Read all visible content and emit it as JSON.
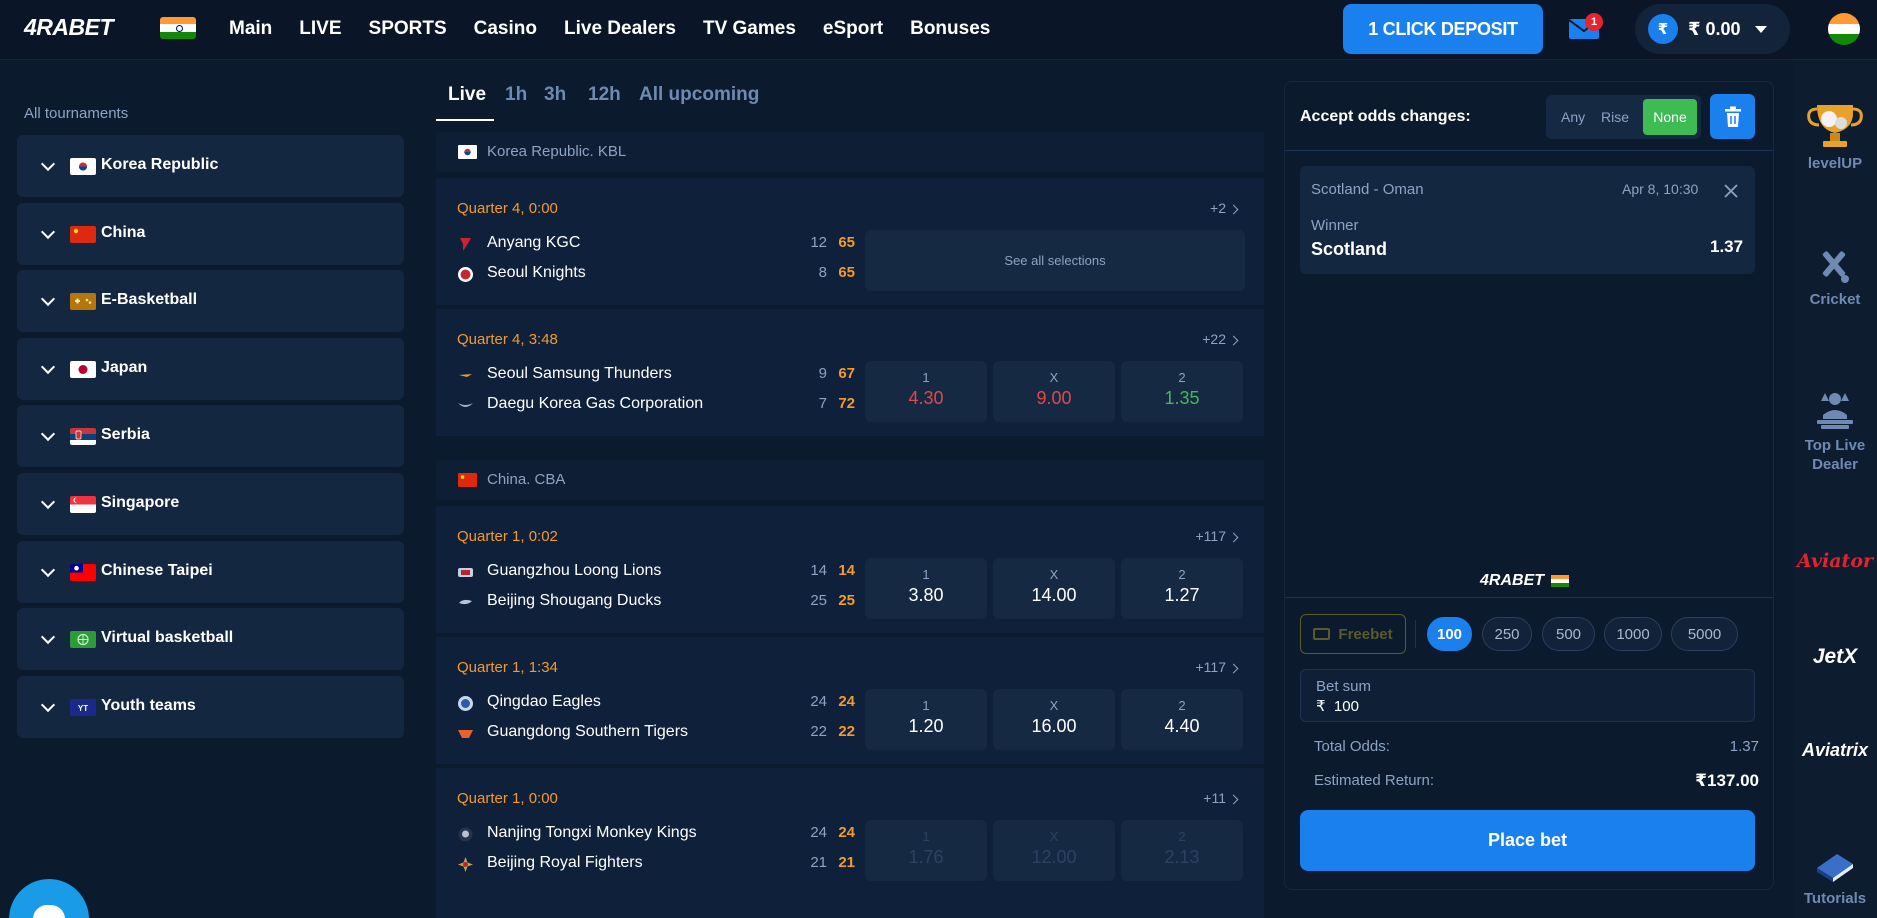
{
  "header": {
    "logo": "4RABET",
    "nav": [
      "Main",
      "LIVE",
      "SPORTS",
      "Casino",
      "Live Dealers",
      "TV Games",
      "eSport",
      "Bonuses"
    ],
    "deposit_label": "1 CLICK DEPOSIT",
    "mail_badge": "1",
    "currency_symbol": "₹",
    "balance": "₹ 0.00"
  },
  "sidebar": {
    "heading": "All tournaments",
    "tournaments": [
      {
        "name": "Korea Republic",
        "flag": "kr"
      },
      {
        "name": "China",
        "flag": "cn"
      },
      {
        "name": "E-Basketball",
        "flag": "eb"
      },
      {
        "name": "Japan",
        "flag": "jp"
      },
      {
        "name": "Serbia",
        "flag": "rs"
      },
      {
        "name": "Singapore",
        "flag": "sg"
      },
      {
        "name": "Chinese Taipei",
        "flag": "tw"
      },
      {
        "name": "Virtual basketball",
        "flag": "vb"
      },
      {
        "name": "Youth teams",
        "flag": "yt"
      }
    ],
    "youth_badge": "YT"
  },
  "tabs": [
    "Live",
    "1h",
    "3h",
    "12h",
    "All upcoming"
  ],
  "leagues": [
    {
      "name": "Korea Republic. KBL",
      "matches": [
        {
          "time": "Quarter 4, 0:00",
          "more": "+2",
          "home": {
            "name": "Anyang KGC",
            "q": "12",
            "total": "65"
          },
          "away": {
            "name": "Seoul Knights",
            "q": "8",
            "total": "65"
          },
          "see_all": "See all selections"
        },
        {
          "time": "Quarter 4, 3:48",
          "more": "+22",
          "home": {
            "name": "Seoul Samsung Thunders",
            "q": "9",
            "total": "67"
          },
          "away": {
            "name": "Daegu Korea Gas Corporation",
            "q": "7",
            "total": "72"
          },
          "odds": [
            {
              "label": "1",
              "value": "4.30"
            },
            {
              "label": "X",
              "value": "9.00"
            },
            {
              "label": "2",
              "value": "1.35"
            }
          ]
        }
      ]
    },
    {
      "name": "China. CBA",
      "matches": [
        {
          "time": "Quarter 1, 0:02",
          "more": "+117",
          "home": {
            "name": "Guangzhou Loong Lions",
            "q": "14",
            "total": "14"
          },
          "away": {
            "name": "Beijing Shougang Ducks",
            "q": "25",
            "total": "25"
          },
          "odds": [
            {
              "label": "1",
              "value": "3.80"
            },
            {
              "label": "X",
              "value": "14.00"
            },
            {
              "label": "2",
              "value": "1.27"
            }
          ]
        },
        {
          "time": "Quarter 1, 1:34",
          "more": "+117",
          "home": {
            "name": "Qingdao Eagles",
            "q": "24",
            "total": "24"
          },
          "away": {
            "name": "Guangdong Southern Tigers",
            "q": "22",
            "total": "22"
          },
          "odds": [
            {
              "label": "1",
              "value": "1.20"
            },
            {
              "label": "X",
              "value": "16.00"
            },
            {
              "label": "2",
              "value": "4.40"
            }
          ]
        },
        {
          "time": "Quarter 1, 0:00",
          "more": "+11",
          "home": {
            "name": "Nanjing Tongxi Monkey Kings",
            "q": "24",
            "total": "24"
          },
          "away": {
            "name": "Beijing Royal Fighters",
            "q": "21",
            "total": "21"
          },
          "odds": [
            {
              "label": "1",
              "value": "1.76"
            },
            {
              "label": "X",
              "value": "12.00"
            },
            {
              "label": "2",
              "value": "2.13"
            }
          ]
        }
      ]
    }
  ],
  "betslip": {
    "odds_changes_label": "Accept odds changes:",
    "odds_options": [
      "Any",
      "Rise",
      "None"
    ],
    "selected_option": "None",
    "bet": {
      "event": "Scotland - Oman",
      "date": "Apr 8, 10:30",
      "market": "Winner",
      "pick": "Scotland",
      "odd": "1.37"
    },
    "logo": "4RABET",
    "freebet_label": "Freebet",
    "quick_amounts": [
      "100",
      "250",
      "500",
      "1000",
      "5000"
    ],
    "selected_amount": "100",
    "bet_sum_label": "Bet sum",
    "bet_sum_currency": "₹",
    "bet_sum_value": "100",
    "total_odds_label": "Total Odds:",
    "total_odds_value": "1.37",
    "est_return_label": "Estimated Return:",
    "est_return_value": "₹137.00",
    "place_bet_label": "Place bet"
  },
  "rail": [
    {
      "label": "levelUP",
      "icon": "trophy-icon"
    },
    {
      "label": "Cricket",
      "icon": "cricket-icon"
    },
    {
      "label": "Top Live Dealer",
      "icon": "dealer-icon"
    },
    {
      "label": "Aviator",
      "icon": "aviator-logo"
    },
    {
      "label": "JetX",
      "icon": "jetx-logo"
    },
    {
      "label": "Aviatrix",
      "icon": "aviatrix-logo"
    },
    {
      "label": "Tutorials",
      "icon": "book-icon"
    }
  ],
  "colors": {
    "accent": "#1a80ee",
    "live_time": "#f39a2d",
    "odd_down": "#e5464b",
    "odd_up": "#3fbb54",
    "aviator": "#e0232f"
  }
}
